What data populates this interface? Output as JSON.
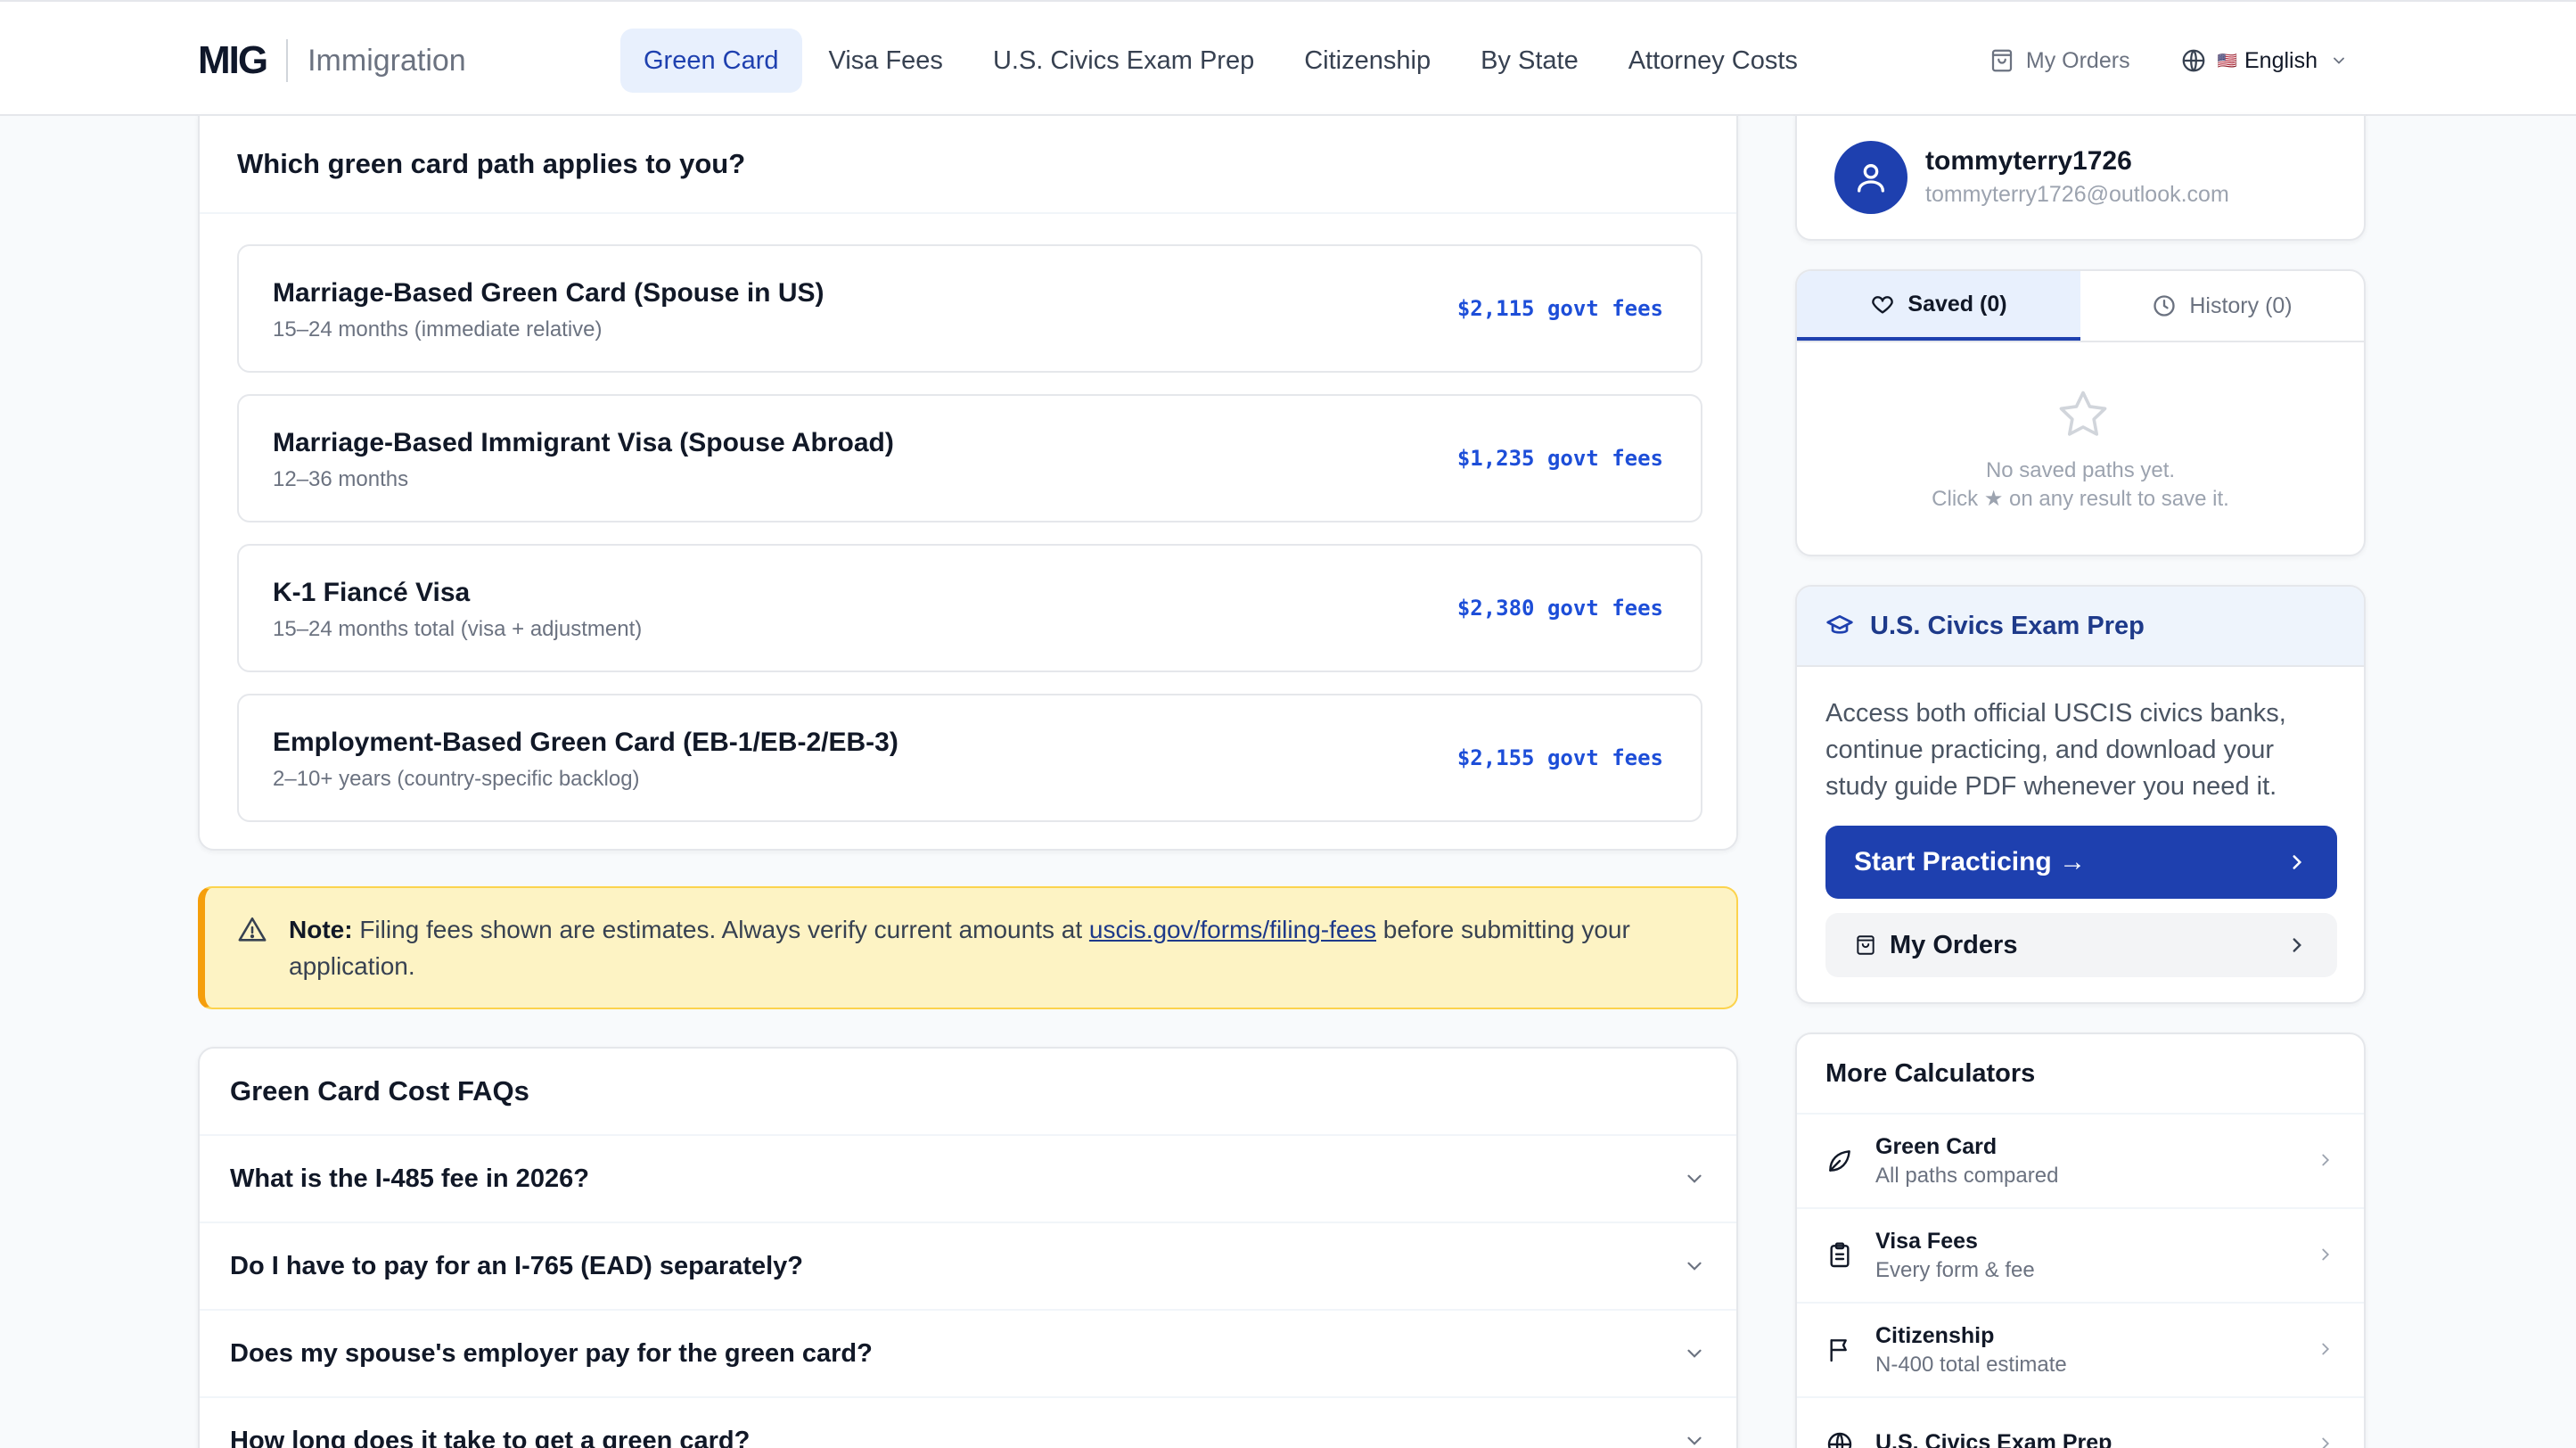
{
  "header": {
    "logo": "MIG",
    "logo_sub": "Immigration",
    "nav": [
      "Green Card",
      "Visa Fees",
      "U.S. Civics Exam Prep",
      "Citizenship",
      "By State",
      "Attorney Costs"
    ],
    "my_orders": "My Orders",
    "language_flag": "🇺🇸",
    "language": "English"
  },
  "paths": {
    "heading": "Which green card path applies to you?",
    "items": [
      {
        "title": "Marriage-Based Green Card (Spouse in US)",
        "subtitle": "15–24 months (immediate relative)",
        "fee": "$2,115 govt fees"
      },
      {
        "title": "Marriage-Based Immigrant Visa (Spouse Abroad)",
        "subtitle": "12–36 months",
        "fee": "$1,235 govt fees"
      },
      {
        "title": "K-1 Fiancé Visa",
        "subtitle": "15–24 months total (visa + adjustment)",
        "fee": "$2,380 govt fees"
      },
      {
        "title": "Employment-Based Green Card (EB-1/EB-2/EB-3)",
        "subtitle": "2–10+ years (country-specific backlog)",
        "fee": "$2,155 govt fees"
      }
    ]
  },
  "note": {
    "label": "Note:",
    "text_before": "Filing fees shown are estimates. Always verify current amounts at",
    "link": "uscis.gov/forms/filing-fees",
    "text_after": "before submitting your application."
  },
  "faq": {
    "heading": "Green Card Cost FAQs",
    "items": [
      "What is the I-485 fee in 2026?",
      "Do I have to pay for an I-765 (EAD) separately?",
      "Does my spouse's employer pay for the green card?",
      "How long does it take to get a green card?"
    ]
  },
  "user": {
    "name": "tommyterry1726",
    "email": "tommyterry1726@outlook.com"
  },
  "saved": {
    "tab_saved": "Saved (0)",
    "tab_history": "History (0)",
    "empty_line1": "No saved paths yet.",
    "empty_line2": "Click ★ on any result to save it."
  },
  "civics": {
    "heading": "U.S. Civics Exam Prep",
    "body": "Access both official USCIS civics banks, continue practicing, and download your study guide PDF whenever you need it.",
    "primary_button": "Start Practicing →",
    "secondary_button": "My Orders"
  },
  "more": {
    "heading": "More Calculators",
    "items": [
      {
        "title": "Green Card",
        "subtitle": "All paths compared",
        "icon": "leaf-icon"
      },
      {
        "title": "Visa Fees",
        "subtitle": "Every form & fee",
        "icon": "clipboard-icon"
      },
      {
        "title": "Citizenship",
        "subtitle": "N-400 total estimate",
        "icon": "flag-icon"
      },
      {
        "title": "U.S. Civics Exam Prep",
        "subtitle": "",
        "icon": "globe-icon"
      }
    ]
  },
  "colors": {
    "accent": "#1e40af",
    "fee_text": "#1d4ed8",
    "note_bg": "#fdf3c4",
    "note_border": "#f59e0b"
  }
}
